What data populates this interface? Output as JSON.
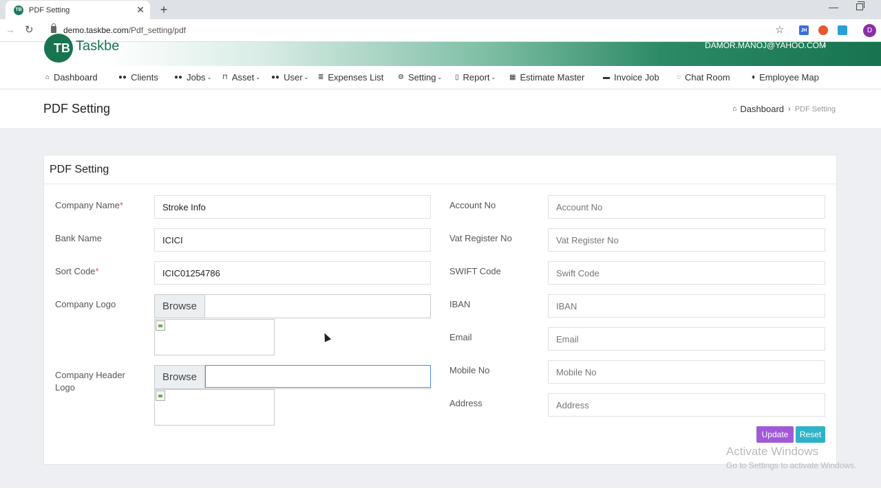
{
  "browser": {
    "tab_title": "PDF Setting",
    "tab_favicon": "TB",
    "url_host": "demo.taskbe.com",
    "url_path": "/Pdf_setting/pdf",
    "ext1": "JH",
    "profile_initial": "D"
  },
  "header": {
    "logo_mark": "TB",
    "logo_text": "Taskbe",
    "user_email": "DAMOR.MANOJ@YAHOO.COM"
  },
  "nav": {
    "items": [
      {
        "label": "Dashboard",
        "icon": "home-icon"
      },
      {
        "label": "Clients",
        "icon": "users-icon"
      },
      {
        "label": "Jobs",
        "icon": "users-icon",
        "dropdown": true
      },
      {
        "label": "Asset",
        "icon": "bookmark-icon",
        "dropdown": true
      },
      {
        "label": "User",
        "icon": "users-icon",
        "dropdown": true
      },
      {
        "label": "Expenses List",
        "icon": "list-icon"
      },
      {
        "label": "Setting",
        "icon": "gears-icon",
        "dropdown": true
      },
      {
        "label": "Report",
        "icon": "file-icon",
        "dropdown": true
      },
      {
        "label": "Estimate Master",
        "icon": "calculator-icon"
      },
      {
        "label": "Invoice Job",
        "icon": "briefcase-icon"
      },
      {
        "label": "Chat Room",
        "icon": "chat-icon"
      },
      {
        "label": "Employee Map",
        "icon": "map-marker-icon"
      }
    ]
  },
  "page": {
    "title": "PDF Setting",
    "breadcrumb_home": "Dashboard",
    "breadcrumb_current": "PDF Setting"
  },
  "card": {
    "title": "PDF Setting",
    "left": {
      "company_name_label": "Company Name",
      "company_name_value": "Stroke Info",
      "bank_name_label": "Bank Name",
      "bank_name_value": "ICICI",
      "sort_code_label": "Sort Code",
      "sort_code_value": "ICIC01254786",
      "company_logo_label": "Company Logo",
      "company_header_logo_label_1": "Company Header",
      "company_header_logo_label_2": "Logo",
      "browse_label": "Browse"
    },
    "right": {
      "account_no_label": "Account No",
      "account_no_placeholder": "Account No",
      "vat_label": "Vat Register No",
      "vat_placeholder": "Vat Register No",
      "swift_label": "SWIFT Code",
      "swift_placeholder": "Swift Code",
      "iban_label": "IBAN",
      "iban_placeholder": "IBAN",
      "email_label": "Email",
      "email_placeholder": "Email",
      "mobile_label": "Mobile No",
      "mobile_placeholder": "Mobile No",
      "address_label": "Address",
      "address_placeholder": "Address"
    },
    "required_mark": "*",
    "update_label": "Update",
    "reset_label": "Reset"
  },
  "watermark": {
    "title": "Activate Windows",
    "subtitle": "Go to Settings to activate Windows."
  },
  "colors": {
    "brand_green": "#17744f",
    "update_button": "#a259d9",
    "reset_button": "#2db3c8",
    "required": "#d9534f"
  }
}
